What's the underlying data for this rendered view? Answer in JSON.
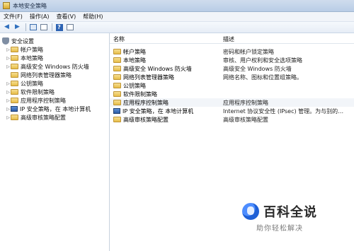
{
  "window": {
    "title": "本地安全策略"
  },
  "menu": [
    {
      "label": "文件(F)"
    },
    {
      "label": "操作(A)"
    },
    {
      "label": "查看(V)"
    },
    {
      "label": "帮助(H)"
    }
  ],
  "toolbar": {
    "back_glyph": "◀",
    "forward_glyph": "▶",
    "help_glyph": "?",
    "icons": [
      "back-icon",
      "forward-icon",
      "console-tree-icon",
      "export-list-icon",
      "help-icon",
      "properties-icon"
    ]
  },
  "tree": {
    "root": "安全设置",
    "items": [
      {
        "label": "帐户策略",
        "icon": "folder-icon",
        "expandable": true
      },
      {
        "label": "本地策略",
        "icon": "folder-icon",
        "expandable": true
      },
      {
        "label": "高级安全 Windows 防火墙",
        "icon": "folder-icon",
        "expandable": true
      },
      {
        "label": "网络列表管理器策略",
        "icon": "folder-icon",
        "expandable": false
      },
      {
        "label": "公钥策略",
        "icon": "folder-icon",
        "expandable": true
      },
      {
        "label": "软件限制策略",
        "icon": "folder-icon",
        "expandable": true
      },
      {
        "label": "应用程序控制策略",
        "icon": "folder-icon",
        "expandable": true
      },
      {
        "label": "IP 安全策略，在 本地计算机",
        "icon": "computer-icon",
        "expandable": true
      },
      {
        "label": "高级审核策略配置",
        "icon": "folder-icon",
        "expandable": true
      }
    ]
  },
  "list": {
    "columns": {
      "name": "名称",
      "description": "描述"
    },
    "rows": [
      {
        "name": "帐户策略",
        "description": "密码和帐户锁定策略",
        "icon": "folder-icon"
      },
      {
        "name": "本地策略",
        "description": "审核、用户权利和安全选项策略",
        "icon": "folder-icon"
      },
      {
        "name": "高级安全 Windows 防火墙",
        "description": "高级安全 Windows 防火墙",
        "icon": "folder-icon"
      },
      {
        "name": "网络列表管理器策略",
        "description": "网络名称、图标和位置组策略。",
        "icon": "folder-icon"
      },
      {
        "name": "公钥策略",
        "description": "",
        "icon": "folder-icon"
      },
      {
        "name": "软件限制策略",
        "description": "",
        "icon": "folder-icon"
      },
      {
        "name": "应用程序控制策略",
        "description": "应用程序控制策略",
        "icon": "folder-icon"
      },
      {
        "name": "IP 安全策略，在 本地计算机",
        "description": "Internet 协议安全性 (IPsec) 管理。为与别的…",
        "icon": "computer-icon"
      },
      {
        "name": "高级审核策略配置",
        "description": "高级审核策略配置",
        "icon": "folder-icon"
      }
    ]
  },
  "watermark": {
    "title": "百科全说",
    "subtitle": "助你轻松解决"
  }
}
